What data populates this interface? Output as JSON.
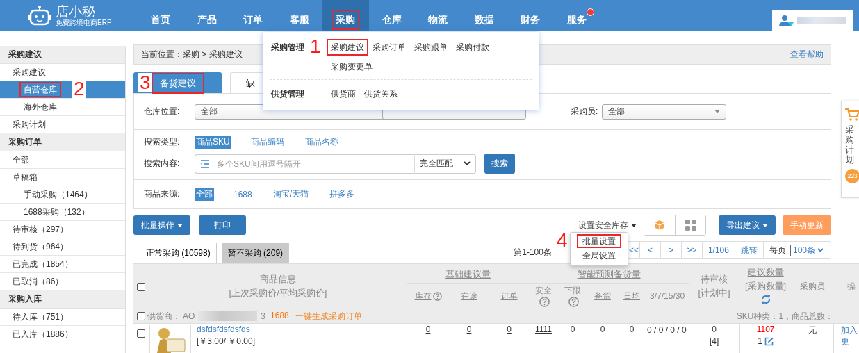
{
  "header": {
    "logo_name": "店小秘",
    "logo_tagline": "免费跨境电商ERP",
    "nav": [
      {
        "label": "首页",
        "selected": false,
        "highlighted": false,
        "badge": false
      },
      {
        "label": "产品",
        "selected": false,
        "highlighted": false,
        "badge": false
      },
      {
        "label": "订单",
        "selected": false,
        "highlighted": false,
        "badge": false
      },
      {
        "label": "客服",
        "selected": false,
        "highlighted": false,
        "badge": false
      },
      {
        "label": "采购",
        "selected": true,
        "highlighted": true,
        "badge": false
      },
      {
        "label": "仓库",
        "selected": false,
        "highlighted": false,
        "badge": false
      },
      {
        "label": "物流",
        "selected": false,
        "highlighted": false,
        "badge": false
      },
      {
        "label": "数据",
        "selected": false,
        "highlighted": false,
        "badge": false
      },
      {
        "label": "财务",
        "selected": false,
        "highlighted": false,
        "badge": false
      },
      {
        "label": "服务",
        "selected": false,
        "highlighted": false,
        "badge": true
      }
    ]
  },
  "dropdown_menu": {
    "groups": [
      {
        "title": "采购管理",
        "items": [
          {
            "label": "采购建议",
            "highlighted": true,
            "annotation": "1"
          },
          {
            "label": "采购订单",
            "highlighted": false
          },
          {
            "label": "采购跟单",
            "highlighted": false
          },
          {
            "label": "采购付款",
            "highlighted": false
          },
          {
            "label": "采购变更单",
            "highlighted": false
          }
        ]
      },
      {
        "title": "供货管理",
        "items": [
          {
            "label": "供货商",
            "highlighted": false
          },
          {
            "label": "供货关系",
            "highlighted": false
          }
        ]
      }
    ]
  },
  "sidebar": {
    "sections": [
      {
        "title": "采购建议",
        "items": [
          {
            "label": "采购建议",
            "selected": false,
            "children": [
              {
                "label": "自营仓库",
                "selected": true,
                "highlighted": true,
                "annotation": "2"
              },
              {
                "label": "海外仓库",
                "selected": false,
                "highlighted": false
              }
            ]
          },
          {
            "label": "采购计划",
            "selected": false
          }
        ]
      },
      {
        "title": "采购订单",
        "items": [
          {
            "label": "全部",
            "selected": false
          },
          {
            "label": "草稿箱",
            "selected": false,
            "children": [
              {
                "label": "手动采购（1464）",
                "selected": false,
                "highlighted": false
              },
              {
                "label": "1688采购（132）",
                "selected": false,
                "highlighted": false
              }
            ]
          },
          {
            "label": "待审核（297）",
            "selected": false
          },
          {
            "label": "待到货（964）",
            "selected": false
          },
          {
            "label": "已完成（1854）",
            "selected": false
          },
          {
            "label": "已取消（86）",
            "selected": false
          }
        ]
      },
      {
        "title": "采购入库",
        "items": [
          {
            "label": "待入库（751）",
            "selected": false
          },
          {
            "label": "已入库（1886）",
            "selected": false
          }
        ]
      }
    ]
  },
  "breadcrumb": {
    "text": "当前位置：采购 > 采购建议",
    "help_link": "查看帮助"
  },
  "tabs": [
    {
      "label": "备货建议",
      "selected": true,
      "highlighted": true,
      "annotation": "3"
    },
    {
      "label": "缺",
      "selected": false,
      "highlighted": false
    }
  ],
  "filters": {
    "selects": [
      {
        "label": "仓库位置:",
        "value": "全部"
      },
      {
        "label": "采购员:",
        "value": "全部"
      }
    ],
    "search_type": {
      "label": "搜索类型:",
      "options": [
        {
          "label": "商品SKU",
          "selected": true
        },
        {
          "label": "商品编码",
          "selected": false
        },
        {
          "label": "商品名称",
          "selected": false
        }
      ]
    },
    "search": {
      "label": "搜索内容:",
      "placeholder": "多个SKU间用逗号隔开",
      "match": "完全匹配",
      "button": "搜索"
    },
    "source": {
      "label": "商品来源:",
      "options": [
        {
          "label": "全部",
          "selected": true
        },
        {
          "label": "1688",
          "selected": false
        },
        {
          "label": "淘宝/天猫",
          "selected": false
        },
        {
          "label": "拼多多",
          "selected": false
        }
      ]
    }
  },
  "toolbar": {
    "batch": "批量操作",
    "print": "打印",
    "safety_stock": "设置安全库存",
    "export": "导出建议",
    "refresh": "手动更新"
  },
  "safety_menu": {
    "items": [
      {
        "label": "批量设置",
        "highlighted": true,
        "annotation": "4"
      },
      {
        "label": "全局设置",
        "highlighted": false
      }
    ]
  },
  "pagination": {
    "range": "第1-100条",
    "buttons": [
      "<<",
      "<",
      ">",
      ">>",
      "1/106",
      "跳转"
    ],
    "per_page_label": "每页",
    "per_page": "100条"
  },
  "list_tabs": [
    {
      "label": "正常采购 (10598)",
      "selected": true
    },
    {
      "label": "暂不采购 (209)",
      "selected": false
    }
  ],
  "table": {
    "header_checked": false,
    "product": "商品信息",
    "product_sub": "[上次采购价/平均采购价]",
    "basic_group": "基础建议量",
    "basic": [
      {
        "label": "库存",
        "help": true,
        "sortable": true
      },
      {
        "label": "在途",
        "help": false,
        "sortable": true
      },
      {
        "label": "订单",
        "help": false,
        "sortable": true
      }
    ],
    "smart_group": "智能预测备货量",
    "smart": [
      {
        "label": "安全",
        "help": true,
        "sortable": false
      },
      {
        "label": "下限",
        "help": true,
        "sortable": false
      },
      {
        "label": "备货",
        "help": false,
        "sortable": true
      },
      {
        "label": "日均",
        "help": false,
        "sortable": true
      },
      {
        "label": "3/7/15/30",
        "help": false,
        "sortable": false
      }
    ],
    "pending": "待审核",
    "pending_sub": "[计划中]",
    "suggest": "建议数量",
    "suggest_sub": "[采购数量]",
    "buyer": "采购员",
    "action": "操",
    "supplier": {
      "checked": false,
      "label": "供货商：",
      "name_start": "AO",
      "name_end": "3",
      "platform": "1688",
      "action": "一键生成采购订单",
      "summary": "SKU种类：1，商品总数："
    },
    "rows": [
      {
        "checked": false,
        "name": "dsfdsfdsfdsfds",
        "price": "[￥3.00/ ￥0.00]",
        "stock": "0",
        "in_transit": "0",
        "orders": "0",
        "safety": "1111",
        "lower": "0",
        "reserve": "0",
        "daily": "0",
        "periods": "0 / 0 / 0 / 0",
        "pending": "0",
        "planned": "[4]",
        "suggest": "1107",
        "purchase": "1",
        "buyer": "无",
        "actions": [
          "加入",
          "更"
        ]
      }
    ]
  },
  "side_widget": {
    "label": "采购计划",
    "count": "223"
  }
}
